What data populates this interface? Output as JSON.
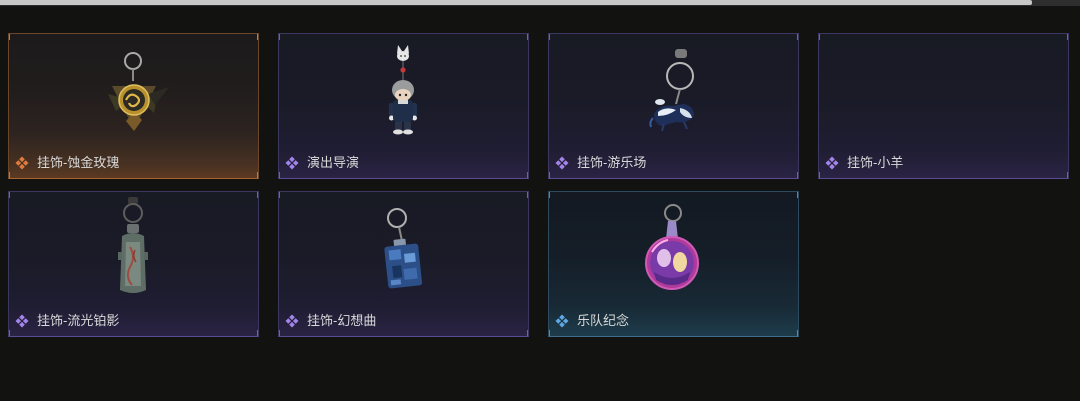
{
  "inventory": {
    "items": [
      {
        "label": "挂饰-蚀金玫瑰",
        "accent": "#e07b3d",
        "rarity_icon": "rarity-diamond-icon",
        "image": "rose-pendant-icon"
      },
      {
        "label": "演出导演",
        "accent": "#a384ea",
        "rarity_icon": "rarity-diamond-icon",
        "image": "director-figure-icon"
      },
      {
        "label": "挂饰-游乐场",
        "accent": "#a384ea",
        "rarity_icon": "rarity-diamond-icon",
        "image": "carousel-pendant-icon"
      },
      {
        "label": "挂饰-小羊",
        "accent": "#a384ea",
        "rarity_icon": "rarity-diamond-icon"
      },
      {
        "label": "挂饰-流光铂影",
        "accent": "#a384ea",
        "rarity_icon": "rarity-diamond-icon",
        "image": "stone-pendant-icon"
      },
      {
        "label": "挂饰-幻想曲",
        "accent": "#a384ea",
        "rarity_icon": "rarity-diamond-icon",
        "image": "blue-cube-pendant-icon"
      },
      {
        "label": "乐队纪念",
        "accent": "#5ea6e4",
        "rarity_icon": "rarity-diamond-icon",
        "image": "band-badge-icon"
      }
    ]
  }
}
